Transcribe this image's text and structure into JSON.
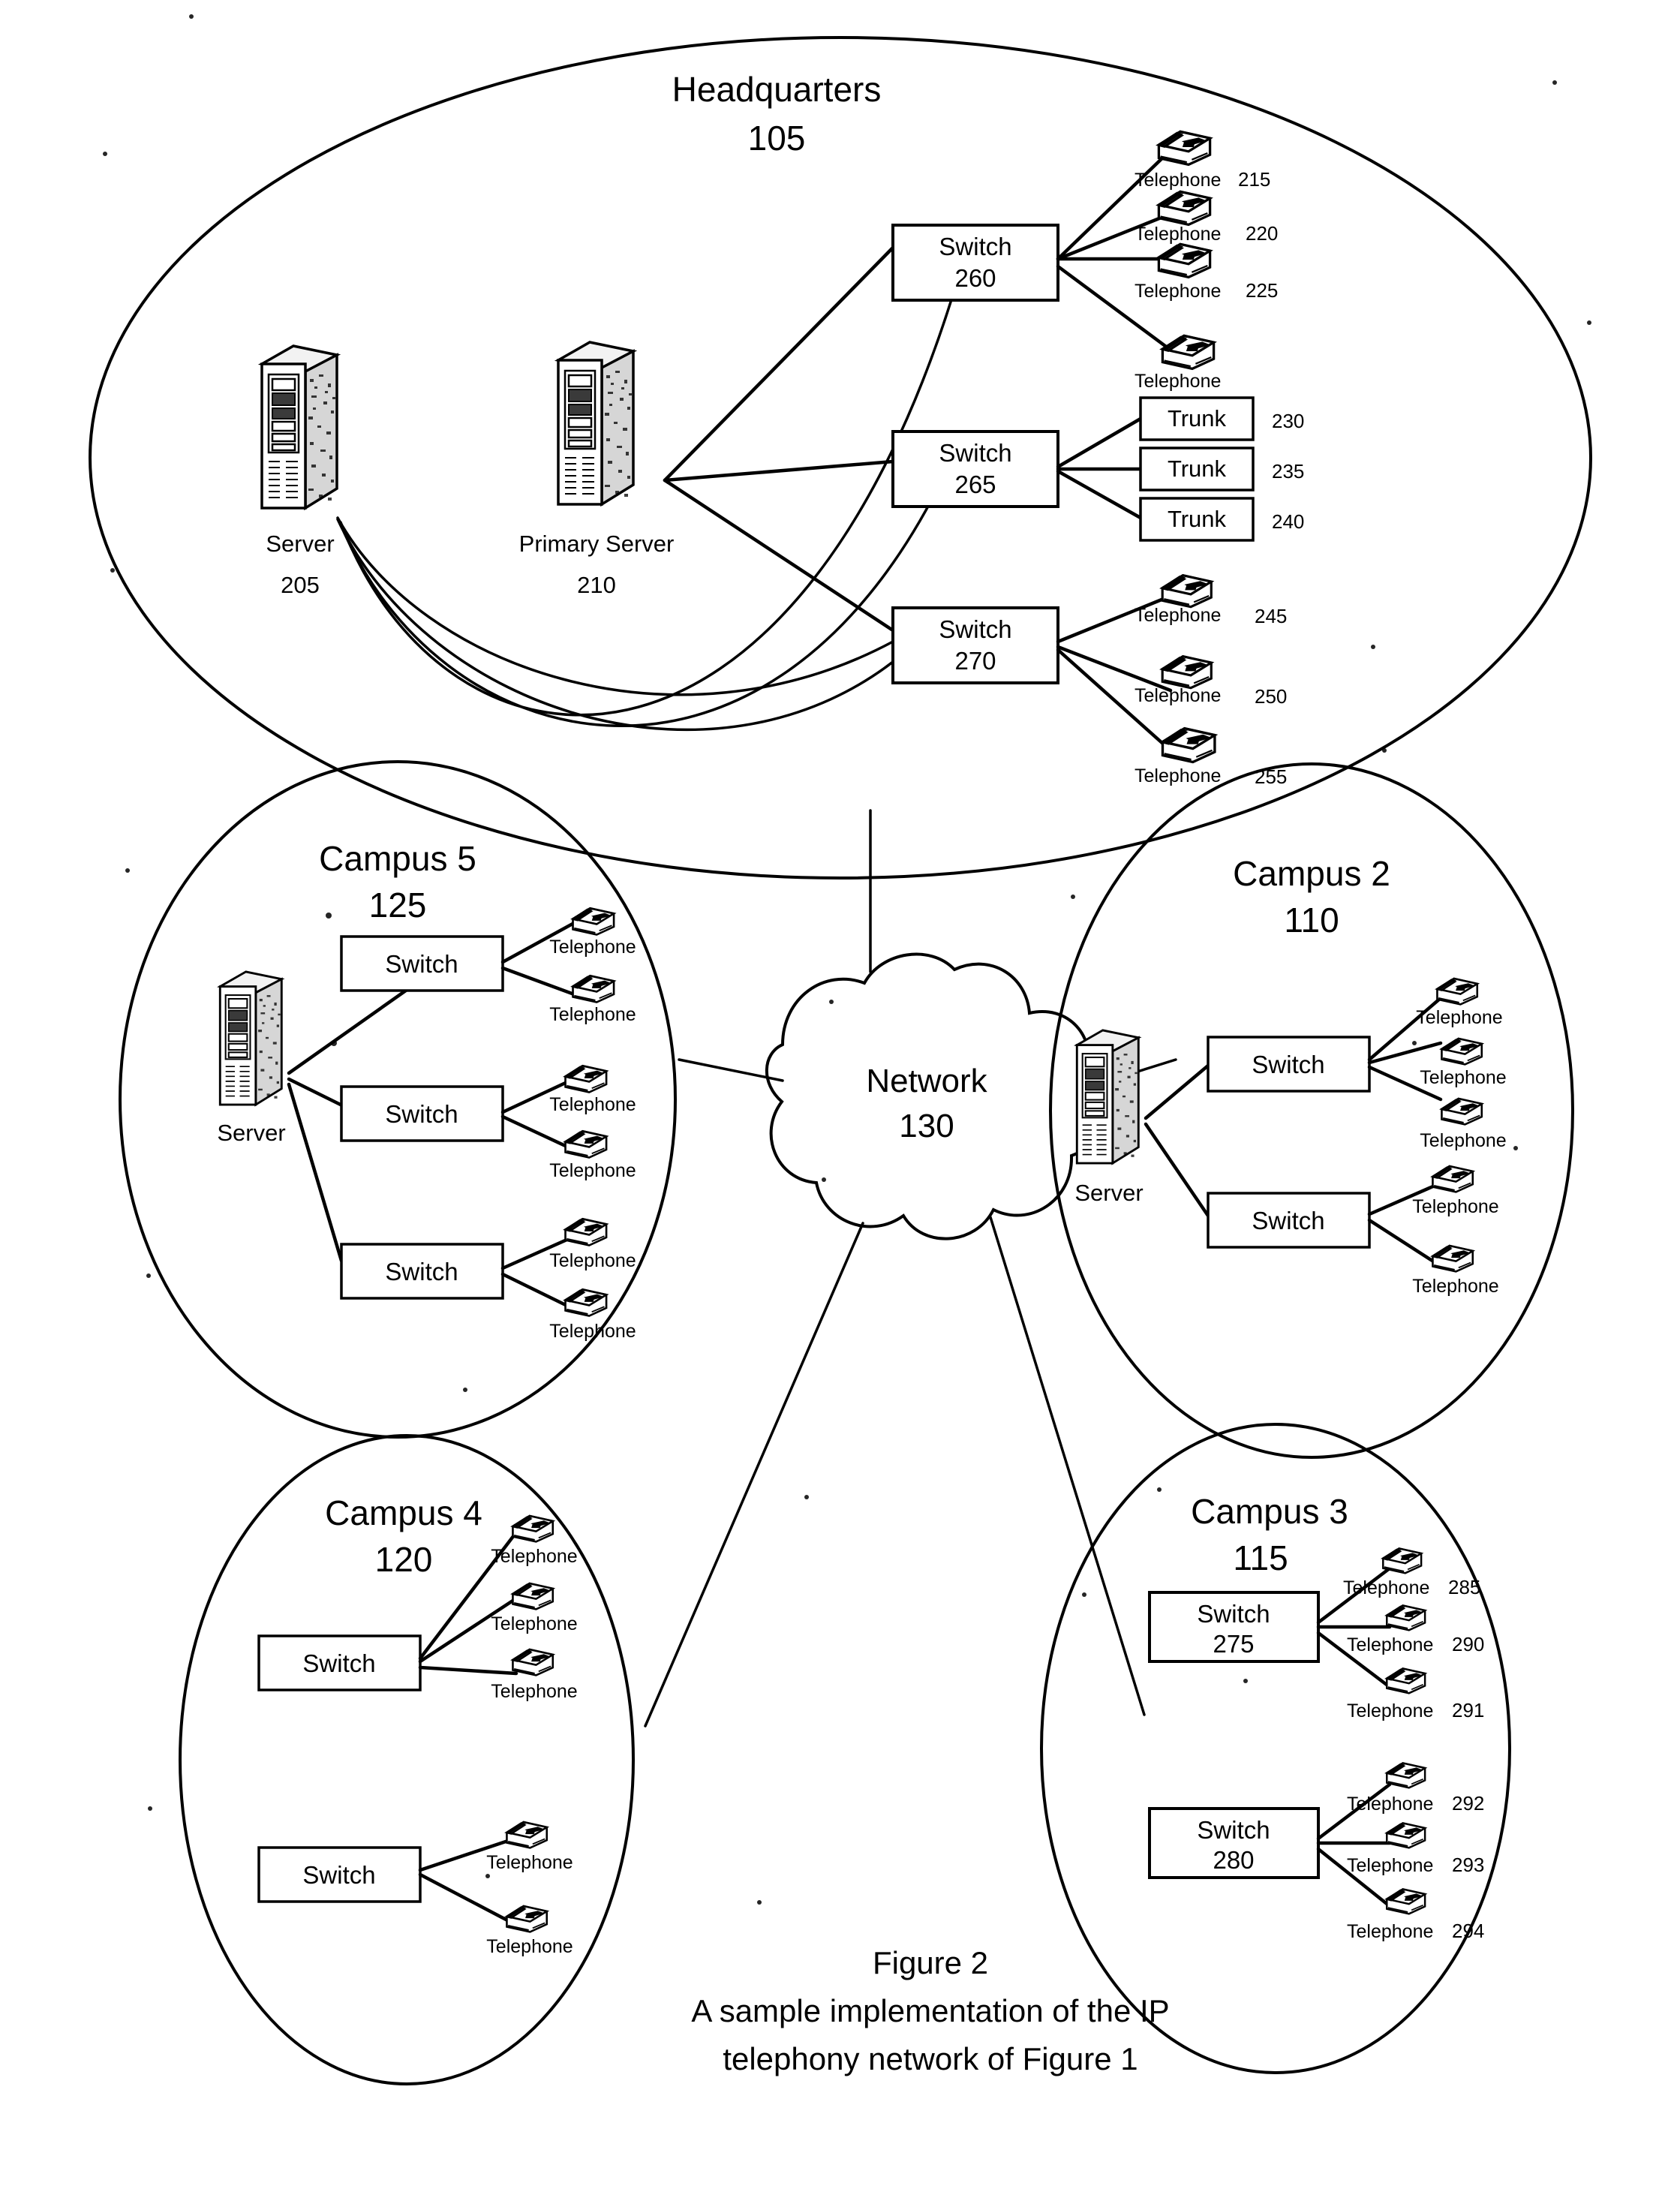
{
  "figure": {
    "caption_line1": "Figure 2",
    "caption_line2": "A sample implementation of the IP",
    "caption_line3": "telephony network of Figure 1"
  },
  "network_cloud": {
    "label": "Network",
    "ref": "130"
  },
  "headquarters": {
    "title": "Headquarters",
    "ref": "105",
    "servers": [
      {
        "label": "Server",
        "ref": "205"
      },
      {
        "label": "Primary Server",
        "ref": "210"
      }
    ],
    "switches": [
      {
        "label": "Switch",
        "ref": "260"
      },
      {
        "label": "Switch",
        "ref": "265"
      },
      {
        "label": "Switch",
        "ref": "270"
      }
    ],
    "switch_260_endpoints": [
      {
        "label": "Telephone",
        "ref": "215"
      },
      {
        "label": "Telephone",
        "ref": "220"
      },
      {
        "label": "Telephone",
        "ref": "225"
      },
      {
        "label": "Telephone",
        "ref": ""
      }
    ],
    "switch_265_endpoints": [
      {
        "label": "Trunk",
        "ref": "230"
      },
      {
        "label": "Trunk",
        "ref": "235"
      },
      {
        "label": "Trunk",
        "ref": "240"
      }
    ],
    "switch_270_endpoints": [
      {
        "label": "Telephone",
        "ref": "245"
      },
      {
        "label": "Telephone",
        "ref": "250"
      },
      {
        "label": "Telephone",
        "ref": "255"
      }
    ]
  },
  "campus5": {
    "title": "Campus 5",
    "ref": "125",
    "server": {
      "label": "Server"
    },
    "switches": [
      {
        "label": "Switch",
        "phones": [
          {
            "label": "Telephone"
          },
          {
            "label": "Telephone"
          }
        ]
      },
      {
        "label": "Switch",
        "phones": [
          {
            "label": "Telephone"
          },
          {
            "label": "Telephone"
          }
        ]
      },
      {
        "label": "Switch",
        "phones": [
          {
            "label": "Telephone"
          },
          {
            "label": "Telephone"
          }
        ]
      }
    ]
  },
  "campus2": {
    "title": "Campus 2",
    "ref": "110",
    "server": {
      "label": "Server"
    },
    "switches": [
      {
        "label": "Switch",
        "phones": [
          {
            "label": "Telephone"
          },
          {
            "label": "Telephone"
          },
          {
            "label": "Telephone"
          }
        ]
      },
      {
        "label": "Switch",
        "phones": [
          {
            "label": "Telephone"
          },
          {
            "label": "Telephone"
          }
        ]
      }
    ]
  },
  "campus4": {
    "title": "Campus 4",
    "ref": "120",
    "switches": [
      {
        "label": "Switch",
        "phones": [
          {
            "label": "Telephone"
          },
          {
            "label": "Telephone"
          },
          {
            "label": "Telephone"
          }
        ]
      },
      {
        "label": "Switch",
        "phones": [
          {
            "label": "Telephone"
          },
          {
            "label": "Telephone"
          }
        ]
      }
    ]
  },
  "campus3": {
    "title": "Campus 3",
    "ref": "115",
    "switches": [
      {
        "label": "Switch",
        "ref": "275",
        "phones": [
          {
            "label": "Telephone",
            "ref": "285"
          },
          {
            "label": "Telephone",
            "ref": "290"
          },
          {
            "label": "Telephone",
            "ref": "291"
          }
        ]
      },
      {
        "label": "Switch",
        "ref": "280",
        "phones": [
          {
            "label": "Telephone",
            "ref": "292"
          },
          {
            "label": "Telephone",
            "ref": "293"
          },
          {
            "label": "Telephone",
            "ref": "294"
          }
        ]
      }
    ]
  }
}
